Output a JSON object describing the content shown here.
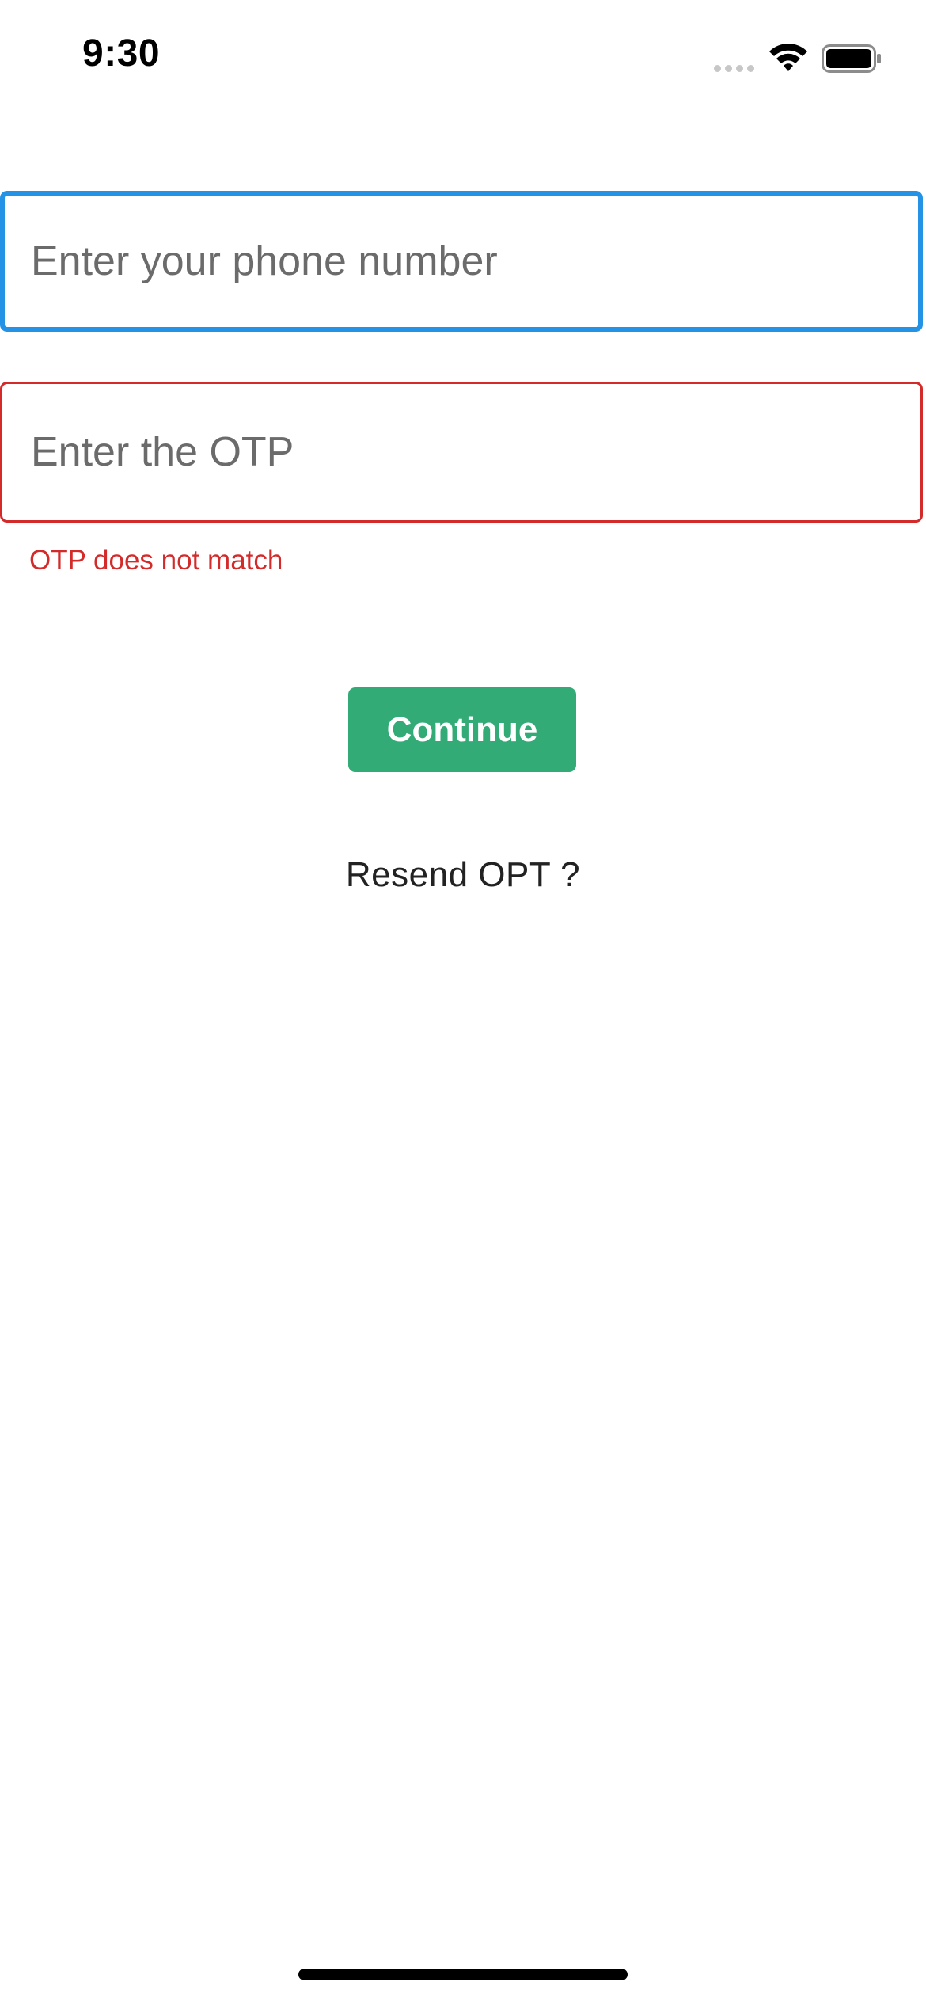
{
  "status_bar": {
    "time": "9:30"
  },
  "form": {
    "phone_placeholder": "Enter your phone number",
    "phone_value": "",
    "otp_placeholder": "Enter the OTP",
    "otp_value": "",
    "otp_error": "OTP does not match",
    "continue_label": "Continue",
    "resend_label": "Resend OPT ?"
  },
  "colors": {
    "focus_border": "#2493e5",
    "error": "#d32a2a",
    "primary_button": "#33ab76"
  },
  "icons": [
    "signal-icon",
    "wifi-icon",
    "battery-icon"
  ]
}
